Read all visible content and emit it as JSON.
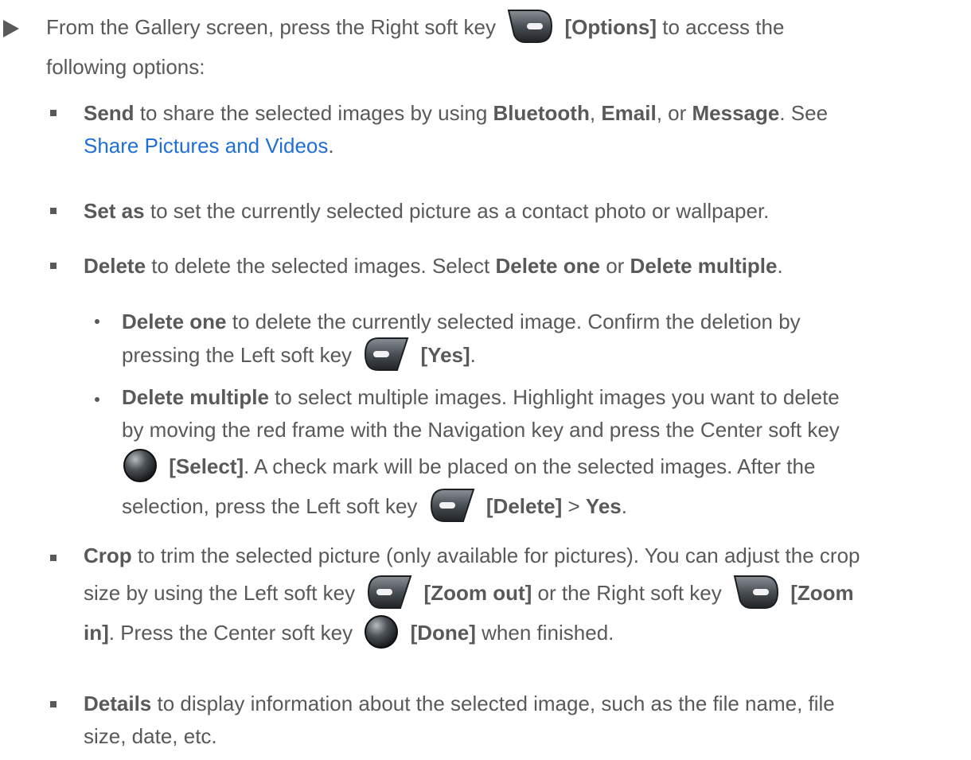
{
  "intro": {
    "line1_pre": "From the Gallery screen, press the Right soft key",
    "line1_key": "[Options]",
    "line1_post": "to access the",
    "line2": "following options:"
  },
  "items": {
    "send": {
      "term": "Send",
      "t1": "to share the selected images by using",
      "bt": "Bluetooth",
      "c1": ",",
      "email": "Email",
      "c2": ", or",
      "msg": "Message",
      "t2": ". See",
      "link": "Share Pictures and Videos",
      "end": "."
    },
    "setas": {
      "term": "Set as",
      "text": "to set the currently selected picture as a contact photo or wallpaper."
    },
    "delete": {
      "term": "Delete",
      "t1": "to delete the selected images. Select",
      "one": "Delete one",
      "or": "or",
      "multiple": "Delete multiple",
      "end": "."
    },
    "delete_one": {
      "term": "Delete one",
      "t1": "to delete the currently selected image. Confirm the deletion by",
      "t2": "pressing the Left soft key",
      "key": "[Yes]",
      "end": "."
    },
    "delete_multiple": {
      "term": "Delete multiple",
      "t1": "to select multiple images. Highlight images you want to delete",
      "t2": "by moving the red frame with the Navigation key and press the Center soft key",
      "key1": "[Select]",
      "t3": ". A check mark will be placed on the selected images. After the",
      "t4": "selection, press the Left soft key",
      "key2": "[Delete]",
      "gt": ">",
      "yes": "Yes",
      "end": "."
    },
    "crop": {
      "term": "Crop",
      "t1": "to trim the selected picture (only available for pictures). You can adjust the crop",
      "t2": "size by using the Left soft key",
      "zout": "[Zoom out]",
      "or": "or the Right soft key",
      "zin1": "[Zoom",
      "zin2": "in]",
      "t3": ". Press the Center soft key",
      "done": "[Done]",
      "t4": "when finished."
    },
    "details": {
      "term": "Details",
      "t1": "to display information about the selected image, such as the file name, file",
      "t2": "size, date, etc."
    }
  },
  "icons": {
    "right_soft_key": "right-soft-key-icon",
    "left_soft_key": "left-soft-key-icon",
    "center_soft_key": "center-soft-key-icon"
  }
}
